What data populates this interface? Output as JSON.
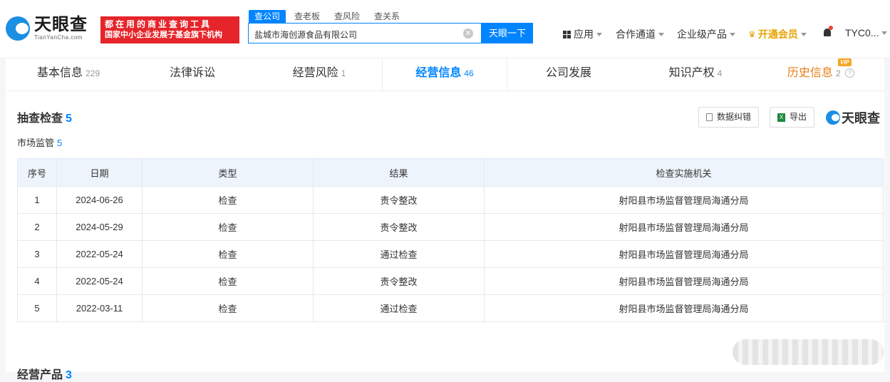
{
  "header": {
    "logo_cn": "天眼查",
    "logo_en": "TianYanCha.com",
    "ad_line1": "都在用的商业查询工具",
    "ad_line2": "国家中小企业发展子基金旗下机构",
    "search_tabs": [
      "查公司",
      "查老板",
      "查风险",
      "查关系"
    ],
    "search_value": "盐城市海创源食品有限公司",
    "search_button": "天眼一下",
    "nav_apps": "应用",
    "nav_partner": "合作通道",
    "nav_enterprise": "企业级产品",
    "nav_vip": "开通会员",
    "nav_user": "TYC0..."
  },
  "tabs": [
    {
      "label": "基本信息",
      "count": "229"
    },
    {
      "label": "法律诉讼",
      "count": ""
    },
    {
      "label": "经营风险",
      "count": "1"
    },
    {
      "label": "经营信息",
      "count": "46"
    },
    {
      "label": "公司发展",
      "count": ""
    },
    {
      "label": "知识产权",
      "count": "4"
    },
    {
      "label": "历史信息",
      "count": "2",
      "badge": "VIP"
    }
  ],
  "section": {
    "title": "抽查检查",
    "count": "5",
    "sub_title": "市场监管",
    "sub_count": "5",
    "btn_correct": "数据纠错",
    "btn_export": "导出",
    "brand": "天眼查"
  },
  "table": {
    "headers": [
      "序号",
      "日期",
      "类型",
      "结果",
      "检查实施机关"
    ],
    "rows": [
      [
        "1",
        "2024-06-26",
        "检查",
        "责令整改",
        "射阳县市场监督管理局海通分局"
      ],
      [
        "2",
        "2024-05-29",
        "检查",
        "责令整改",
        "射阳县市场监督管理局海通分局"
      ],
      [
        "3",
        "2022-05-24",
        "检查",
        "通过检查",
        "射阳县市场监督管理局海通分局"
      ],
      [
        "4",
        "2022-05-24",
        "检查",
        "责令整改",
        "射阳县市场监督管理局海通分局"
      ],
      [
        "5",
        "2022-03-11",
        "检查",
        "通过检查",
        "射阳县市场监督管理局海通分局"
      ]
    ]
  },
  "next_section": {
    "title": "经营产品",
    "count": "3"
  }
}
